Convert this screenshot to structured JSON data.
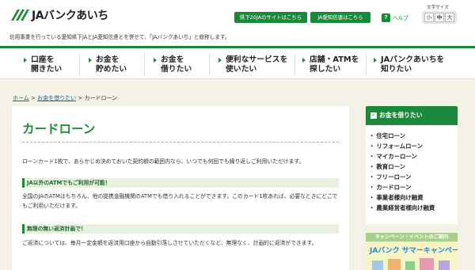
{
  "header": {
    "logo_text": "JAバンクあいち",
    "tagline": "信用事業を行っている愛知県下JAとJA愛知信連とを併せて、「JAバンクあいち」と総称します。",
    "links": [
      {
        "label": "県下20JAのサイトはこちら"
      },
      {
        "label": "JA愛知信連はこちら"
      }
    ],
    "help_icon": "?",
    "help_label": "ヘルプ",
    "font_size_label": "文字サイズ",
    "font_sizes": [
      "小",
      "中",
      "大"
    ]
  },
  "nav": {
    "items": [
      {
        "l1": "口座を",
        "l2": "開きたい"
      },
      {
        "l1": "お金を",
        "l2": "貯めたい"
      },
      {
        "l1": "お金を",
        "l2": "借りたい"
      },
      {
        "l1": "便利なサービスを",
        "l2": "使いたい"
      },
      {
        "l1": "店舗・ATMを",
        "l2": "探したい"
      },
      {
        "l1": "JAバンクあいちを",
        "l2": "知りたい"
      }
    ]
  },
  "breadcrumb": {
    "home": "ホーム",
    "sep1": " > ",
    "parent": "お金を借りたい",
    "sep2": " > ",
    "current": "カードローン"
  },
  "content": {
    "title": "カードローン",
    "intro": "ローンカード1枚で、あらかじめ決めておいた契約額の範囲内なら、いつでも何回でも繰り返しご利用いただけます。",
    "sections": [
      {
        "heading": "JA以外のATMでもご利用が可能！",
        "body": "全国のJAのATMはもちろん、他の提携金融機関のATMでも借り入れることができます。このカード1枚あれば、必要なときにどこでもご利用いただけます。"
      },
      {
        "heading": "無理の無い返済計画で！",
        "body": "ご返済については、毎月一定金額を返済用口座から自動引落しさせていただくなど、無理なく、計画的に返済ができます。"
      }
    ]
  },
  "sidebar": {
    "heading": "お金を借りたい",
    "items": [
      {
        "label": "住宅ローン"
      },
      {
        "label": "リフォームローン"
      },
      {
        "label": "マイカーローン"
      },
      {
        "label": "教育ローン"
      },
      {
        "label": "フリーローン"
      },
      {
        "label": "カードローン"
      },
      {
        "label": "事業者様向け融資"
      },
      {
        "label": "農業経営者様向け融資"
      }
    ],
    "bullet": "・",
    "campaign_heading": "キャンペーン・イベントのご案内",
    "campaign_title": "JAバンク サマーキャンペーン"
  },
  "colors": {
    "brand_green": "#1a8a3a",
    "page_bg": "#f4f1e6",
    "link_blue": "#1a6a9a"
  }
}
